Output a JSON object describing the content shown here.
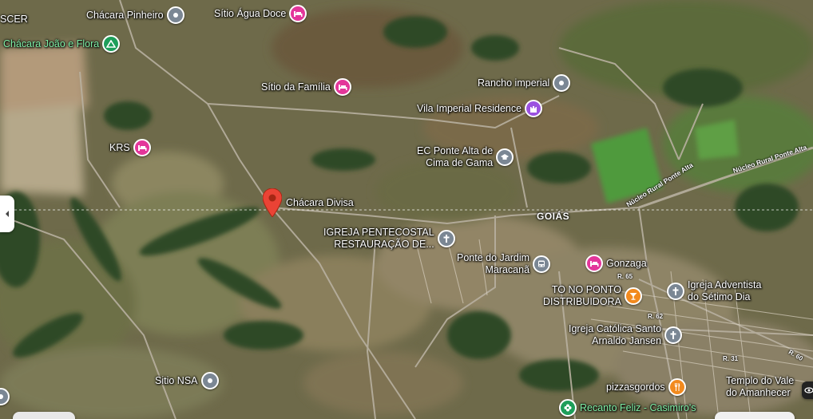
{
  "map": {
    "area_label": "GOIÁS",
    "selected_place": "Chácara Divisa",
    "pois": [
      {
        "name": "Chácara Pinheiro",
        "icon": "place-icon",
        "color": "grey"
      },
      {
        "name": "Sítio Água Doce",
        "icon": "lodging-icon",
        "color": "pink"
      },
      {
        "name": "Chácara João e Flora",
        "icon": "campground-icon",
        "color": "green"
      },
      {
        "name": "Sítio da Família",
        "icon": "lodging-icon",
        "color": "pink"
      },
      {
        "name": "Rancho imperial",
        "icon": "place-icon",
        "color": "grey"
      },
      {
        "name": "Vila Imperial Residence",
        "icon": "castle-icon",
        "color": "purple"
      },
      {
        "name": "KRS",
        "icon": "lodging-icon",
        "color": "pink"
      },
      {
        "name": "EC Ponte Alta de\nCima de Gama",
        "icon": "school-icon",
        "color": "grey"
      },
      {
        "name": "IGREJA PENTECOSTAL\nRESTAURAÇÃO DE...",
        "icon": "church-icon",
        "color": "grey"
      },
      {
        "name": "Ponte do Jardim\nMaracanã",
        "icon": "bus-icon",
        "color": "grey"
      },
      {
        "name": "Gonzaga",
        "icon": "lodging-icon",
        "color": "pink"
      },
      {
        "name": "TO NO PONTO\nDISTRIBUIDORA",
        "icon": "bar-icon",
        "color": "orange"
      },
      {
        "name": "Igreja Adventista\ndo Sétimo Dia",
        "icon": "church-icon",
        "color": "grey"
      },
      {
        "name": "Igreja Católica Santo\nArnaldo Jansen",
        "icon": "church-icon",
        "color": "grey"
      },
      {
        "name": "Sitio NSA",
        "icon": "place-icon",
        "color": "grey"
      },
      {
        "name": "pizzasgordos",
        "icon": "restaurant-icon",
        "color": "orange"
      },
      {
        "name": "Templo do Vale\ndo Amanhecer",
        "icon": "place-icon",
        "color": "none"
      },
      {
        "name": "Recanto Feliz - Casimiro's",
        "icon": "flower-icon",
        "color": "green"
      },
      {
        "name": "SCER",
        "icon": "none",
        "color": "none"
      }
    ],
    "roads": [
      "Núcleo Rural Ponte Alta",
      "Núcleo Rural Ponte Alta",
      "R. 65",
      "R. 62",
      "R. 31",
      "R. 60"
    ],
    "colors": {
      "marker_red": "#ea4335",
      "lodging_pink": "#e3369a",
      "place_grey": "#7b8794",
      "food_orange": "#f28a1e",
      "castle_purple": "#9b51e0",
      "park_green": "#1e9e5a"
    }
  }
}
